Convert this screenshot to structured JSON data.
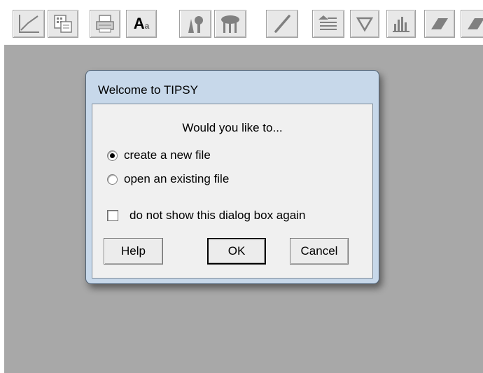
{
  "toolbar": {
    "tools": [
      {
        "icon": "line-graph-icon"
      },
      {
        "icon": "copy-document-icon"
      },
      {
        "icon": "printer-icon"
      },
      {
        "icon": "text-font-icon",
        "glyph": "A",
        "sub": "a"
      },
      {
        "icon": "single-tree-icon"
      },
      {
        "icon": "multiple-trees-icon"
      },
      {
        "icon": "pencil-icon"
      },
      {
        "icon": "align-text-icon"
      },
      {
        "icon": "triangle-down-icon"
      },
      {
        "icon": "bar-chart-icon"
      },
      {
        "icon": "eraser-icon"
      },
      {
        "icon": "eraser-icon-partial"
      }
    ]
  },
  "dialog": {
    "title": "Welcome to TIPSY",
    "prompt": "Would you like to...",
    "options": [
      {
        "label": "create a new file",
        "selected": true
      },
      {
        "label": "open an existing file",
        "selected": false
      }
    ],
    "checkbox": {
      "label": "do not show this dialog box again",
      "checked": false
    },
    "buttons": {
      "help": "Help",
      "ok": "OK",
      "cancel": "Cancel"
    }
  },
  "colors": {
    "workspace": "#a8a8a8",
    "dialog_frame": "#c7d8ea",
    "dialog_body": "#f0f0f0"
  }
}
